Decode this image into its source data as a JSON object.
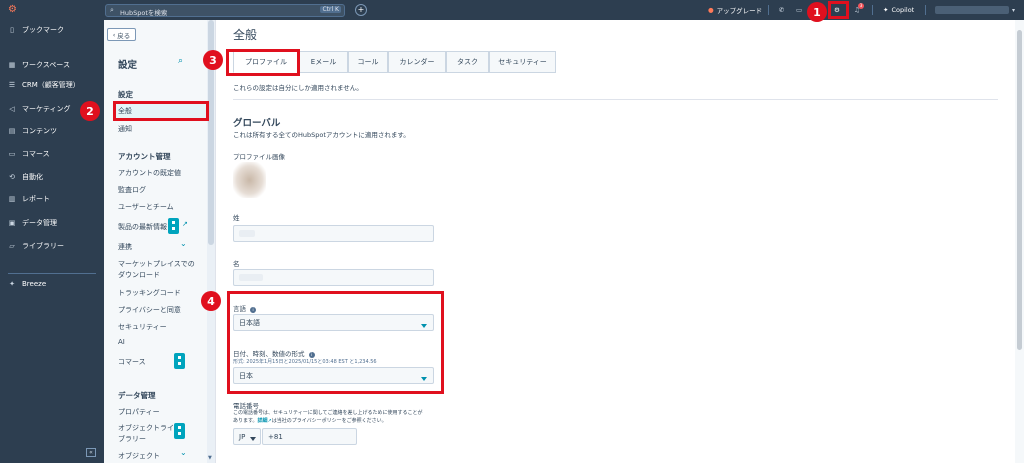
{
  "topbar": {
    "search_placeholder": "HubSpotを検索",
    "shortcut": "Ctrl K",
    "plus": "+",
    "upgrade": "アップグレード",
    "notification_count": "3",
    "copilot": "Copilot"
  },
  "nav": {
    "items": [
      {
        "icon": "bookmark-icon",
        "glyph": "▯",
        "label": "ブックマーク"
      },
      {
        "icon": "workspace-icon",
        "glyph": "▦",
        "label": "ワークスペース"
      },
      {
        "icon": "crm-icon",
        "glyph": "☰",
        "label": "CRM（顧客管理）"
      },
      {
        "icon": "marketing-icon",
        "glyph": "◁",
        "label": "マーケティング"
      },
      {
        "icon": "content-icon",
        "glyph": "▤",
        "label": "コンテンツ"
      },
      {
        "icon": "commerce-icon",
        "glyph": "▭",
        "label": "コマース"
      },
      {
        "icon": "automation-icon",
        "glyph": "⟲",
        "label": "自動化"
      },
      {
        "icon": "reports-icon",
        "glyph": "▥",
        "label": "レポート"
      },
      {
        "icon": "data-icon",
        "glyph": "▣",
        "label": "データ管理"
      },
      {
        "icon": "library-icon",
        "glyph": "▱",
        "label": "ライブラリー"
      }
    ],
    "breeze": "Breeze",
    "collapse": "«"
  },
  "settings": {
    "back": "戻る",
    "title": "設定",
    "section_settings": "設定",
    "general": "全般",
    "notifications": "通知",
    "account_head": "アカウント管理",
    "account_defaults": "アカウントの既定値",
    "audit_log": "監査ログ",
    "users_teams": "ユーザーとチーム",
    "product_updates": "製品の最新情報",
    "integrations": "連携",
    "marketplace_1": "マーケットプレイスでの",
    "marketplace_2": "ダウンロード",
    "tracking_code": "トラッキングコード",
    "privacy": "プライバシーと同意",
    "security": "セキュリティー",
    "ai": "AI",
    "commerce": "コマース",
    "data_head": "データ管理",
    "properties": "プロパティー",
    "object_library_1": "オブジェクトライ",
    "object_library_2": "ブラリー",
    "objects": "オブジェクト"
  },
  "main": {
    "title": "全般",
    "tabs": [
      "プロファイル",
      "Eメール",
      "コール",
      "カレンダー",
      "タスク",
      "セキュリティー"
    ],
    "note": "これらの設定は自分にしか適用されません。",
    "global_title": "グローバル",
    "global_desc": "これは所有する全てのHubSpotアカウントに適用されます。",
    "profile_image": "プロファイル画像",
    "last_name": "姓",
    "first_name": "名",
    "language": "言語",
    "language_value": "日本語",
    "date_format": "日付、時刻、数値の形式",
    "date_example": "形式: 2025年1月15日と2025/01/15と03:48 EST と1,234.56",
    "date_value": "日本",
    "phone": "電話番号",
    "phone_desc_1": "この電話番号は、セキュリティーに関してご連絡を差し上げるために使用することが",
    "phone_desc_2": "あります。",
    "phone_link": "詳細",
    "phone_desc_3": "は当社のプライバシーポリシーをご参照ください。",
    "country": "JP",
    "phone_value": "+81"
  },
  "annotations": [
    "1",
    "2",
    "3",
    "4"
  ],
  "colors": {
    "nav_bg": "#2d3e50",
    "accent": "#00a4bd",
    "highlight": "#e0101e"
  }
}
